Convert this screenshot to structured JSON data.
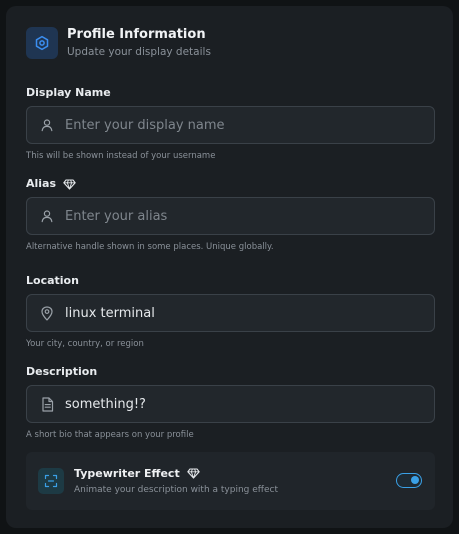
{
  "header": {
    "title": "Profile Information",
    "subtitle": "Update your display details",
    "icon": "hexagon-settings-icon"
  },
  "fields": {
    "display_name": {
      "label": "Display Name",
      "placeholder": "Enter your display name",
      "value": "",
      "hint": "This will be shown instead of your username",
      "icon": "user-icon"
    },
    "alias": {
      "label": "Alias",
      "placeholder": "Enter your alias",
      "value": "",
      "hint": "Alternative handle shown in some places. Unique globally.",
      "icon": "user-icon",
      "badge_icon": "gem-icon"
    },
    "location": {
      "label": "Location",
      "placeholder": "",
      "value": "linux terminal",
      "hint": "Your city, country, or region",
      "icon": "map-pin-icon"
    },
    "description": {
      "label": "Description",
      "placeholder": "",
      "value": "something!?",
      "hint": "A short bio that appears on your profile",
      "icon": "file-text-icon"
    }
  },
  "typewriter": {
    "title": "Typewriter Effect",
    "description": "Animate your description with a typing effect",
    "enabled": true,
    "icon": "scan-text-icon",
    "badge_icon": "gem-icon"
  },
  "colors": {
    "accent": "#3aa0e6",
    "background": "#1b1f23",
    "input_bg": "#22272c",
    "border": "#3a4148"
  }
}
